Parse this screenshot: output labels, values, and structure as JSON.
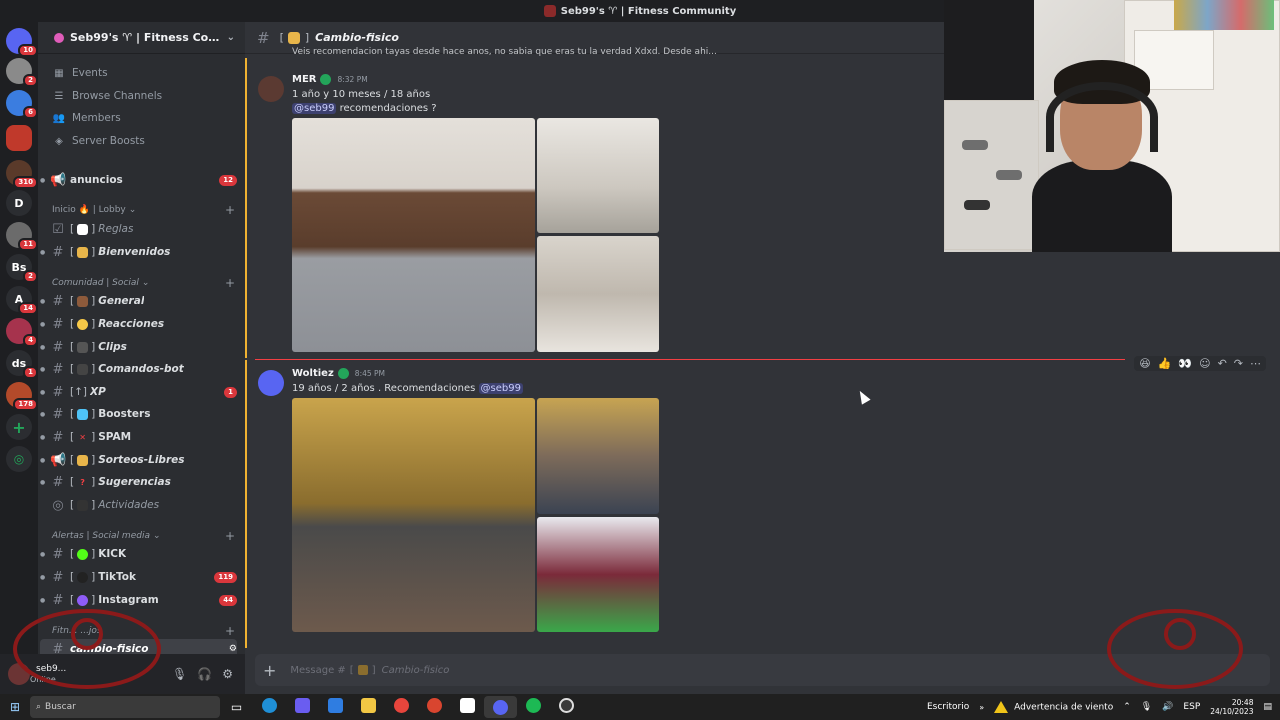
{
  "window": {
    "title": "Seb99's ♈ | Fitness Community"
  },
  "rail": [
    {
      "label": "",
      "badge": "10",
      "color": "#5865f2"
    },
    {
      "label": "",
      "badge": "2",
      "color": "#8a8a8a"
    },
    {
      "label": "",
      "badge": "6",
      "color": "#3b7de0"
    },
    {
      "label": "",
      "badge": "",
      "color": "#c0392b"
    },
    {
      "label": "",
      "badge": "310",
      "color": "#5a3a2a"
    },
    {
      "label": "D",
      "badge": "",
      "color": "#2b2d31"
    },
    {
      "label": "",
      "badge": "11",
      "color": "#6b6b6b"
    },
    {
      "label": "Bs",
      "badge": "2",
      "color": "#2b2d31"
    },
    {
      "label": "A",
      "badge": "14",
      "color": "#2b2d31"
    },
    {
      "label": "",
      "badge": "4",
      "color": "#a6334d"
    },
    {
      "label": "ds",
      "badge": "1",
      "color": "#2b2d31"
    },
    {
      "label": "",
      "badge": "178",
      "color": "#b34a2a"
    }
  ],
  "server": {
    "name": "Seb99's ♈ | Fitness Com..."
  },
  "nav": [
    {
      "label": "Events",
      "icon": "calendar-icon"
    },
    {
      "label": "Browse Channels",
      "icon": "list-icon"
    },
    {
      "label": "Members",
      "icon": "members-icon"
    },
    {
      "label": "Server Boosts",
      "icon": "boost-icon"
    }
  ],
  "channels": {
    "anuncios": {
      "label": "anuncios",
      "badge": "12"
    },
    "cat_inicio": "Inicio 🔥 | Lobby",
    "reglas": "Reglas",
    "bienvenidos": "Bienvenidos",
    "cat_comunidad": "Comunidad | Social",
    "general": "General",
    "reacciones": "Reacciones",
    "clips": "Clips",
    "comandos": "Comandos-bot",
    "xp": {
      "label": "XP",
      "badge": "1"
    },
    "boosters": "Boosters",
    "spam": "SPAM",
    "sorteos": "Sorteos-Libres",
    "sugerencias": "Sugerencias",
    "actividades": "Actividades",
    "cat_alertas": "Alertas | Social media",
    "kick": "KICK",
    "tiktok": {
      "label": "TikTok",
      "badge": "119"
    },
    "instagram": {
      "label": "Instagram",
      "badge": "44"
    },
    "cat_fit": "Fitn... ...jos",
    "cambio_side": "cambio-fisico"
  },
  "user": {
    "name": "seb9...",
    "status": "Online"
  },
  "chat": {
    "channel": "Cambio-fisico",
    "cut_text": "Veis recomendacion tayas desde hace anos, no sabia que eras tu la verdad Xdxd. Desde ahi...",
    "messages": [
      {
        "author": "MER",
        "time": "8:32 PM",
        "line1": "1 año y 10 meses / 18 años",
        "mention": "@seb99",
        "line2_rest": " recomendaciones ?"
      },
      {
        "author": "Woltiez",
        "time": "8:45 PM",
        "line1": "19 años / 2 años . Recomendaciones ",
        "mention": "@seb99"
      }
    ],
    "composer_prefix": "Message # ",
    "composer_channel": "Cambio-fisico"
  },
  "taskbar": {
    "search": "Buscar",
    "desktop": "Escritorio",
    "weather": "Advertencia de viento",
    "lang": "ESP",
    "time": "20:48",
    "date": "24/10/2023"
  }
}
